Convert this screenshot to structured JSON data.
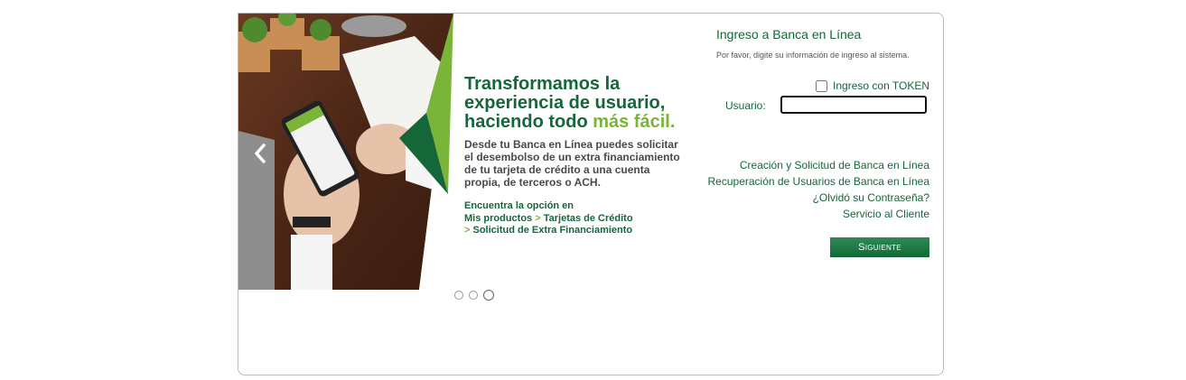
{
  "banner": {
    "title_line1": "Transformamos la",
    "title_line2": "experiencia de usuario,",
    "title_line3_prefix": "haciendo todo ",
    "title_line3_highlight": "más fácil.",
    "body": "Desde tu Banca en Línea puedes solicitar el desembolso de un extra financiamiento de tu tarjeta de crédito a una cuenta propia, de terceros o ACH.",
    "find_intro": "Encuentra la opción en",
    "path_1": "Mis productos",
    "path_sep": ">",
    "path_2": "Tarjetas de Crédito",
    "path_3": "Solicitud de Extra Financiamiento",
    "prev_icon": "chevron-left-icon",
    "slide_count": 3,
    "active_slide": 3
  },
  "login": {
    "title": "Ingreso a Banca en Línea",
    "subtitle": "Por favor, digite su información de ingreso al sistema.",
    "token_label": "Ingreso con TOKEN",
    "token_checked": false,
    "user_label": "Usuario:",
    "user_value": "",
    "links": [
      "Creación y Solicitud de Banca en Línea",
      "Recuperación de Usuarios de Banca en Línea",
      "¿Olvidó su Contraseña?",
      "Servicio al Cliente"
    ],
    "next_button": "Siguiente"
  },
  "colors": {
    "brand_green": "#15673a",
    "accent_green": "#7ab539",
    "button_green": "#1a7a43"
  }
}
